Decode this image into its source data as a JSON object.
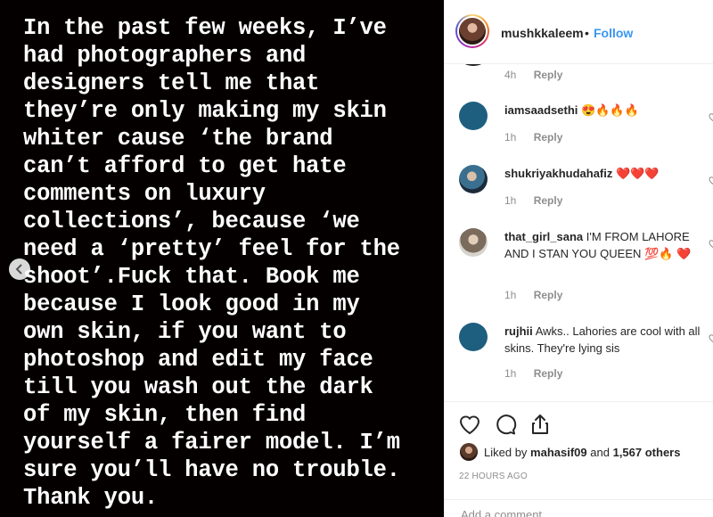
{
  "post": {
    "story_lines": [
      "In the past few weeks, I’ve",
      "had photographers and",
      "designers tell me that",
      "they’re only making my skin",
      "whiter cause ‘the brand",
      "can’t afford to get hate",
      "comments on luxury",
      "collections’, because ‘we",
      "need a ‘pretty’ feel for the",
      "shoot’.Fuck that. Book me",
      "because I look good in my",
      "own skin, if you want to",
      "photoshop and edit my face",
      "till you wash out the dark",
      "of my skin, then find",
      "yourself a fairer model. I’m",
      "sure you’ll have no trouble.",
      "Thank you."
    ]
  },
  "header": {
    "username": "mushkkaleem",
    "separator": "•",
    "follow_label": "Follow"
  },
  "comments": {
    "top_partial": {
      "time": "4h",
      "reply_label": "Reply"
    },
    "items": [
      {
        "user": "iamsaadsethi",
        "text": "😍🔥🔥🔥",
        "time": "1h",
        "reply_label": "Reply"
      },
      {
        "user": "shukriyakhudahafiz",
        "text": "❤️❤️❤️",
        "time": "1h",
        "reply_label": "Reply"
      },
      {
        "user": "that_girl_sana",
        "text": "I'M FROM LAHORE AND I STAN YOU QUEEN 💯🔥 ❤️",
        "time": "1h",
        "reply_label": "Reply"
      },
      {
        "user": "rujhii",
        "text": "Awks.. Lahories are cool with all skins. They're lying sis",
        "time": "1h",
        "reply_label": "Reply"
      }
    ]
  },
  "likes": {
    "prefix": "Liked by",
    "user": "mahasif09",
    "middle": "and",
    "count": "1,567 others"
  },
  "timestamp": "22 HOURS AGO",
  "add_comment": {
    "placeholder": "Add a comment..."
  },
  "colors": {
    "accent": "#3897f0",
    "image_bg": "#050000",
    "avatar_blue": "#1e5f7f"
  }
}
